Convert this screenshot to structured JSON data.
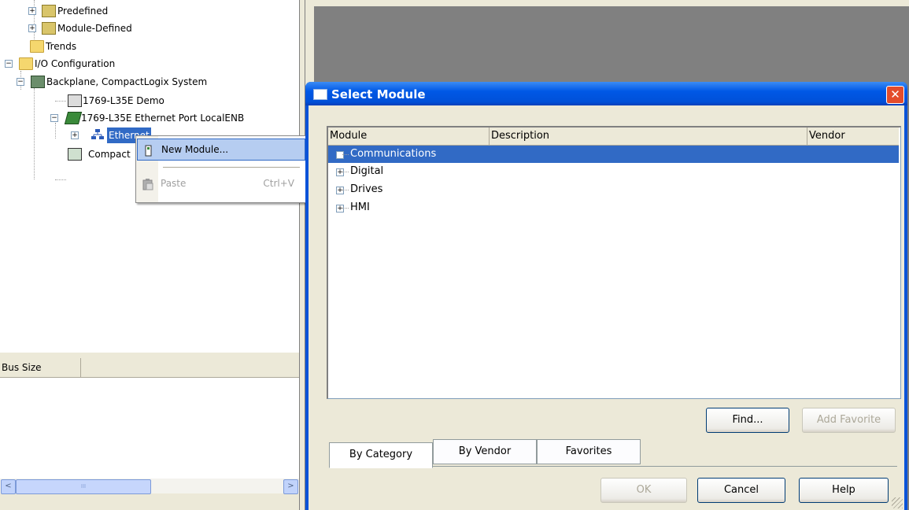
{
  "tree": {
    "items": [
      {
        "label": "Predefined",
        "expander": "+"
      },
      {
        "label": "Module-Defined",
        "expander": "+"
      },
      {
        "label": "Trends",
        "expander": ""
      },
      {
        "label": "I/O Configuration",
        "expander": "−"
      },
      {
        "label": "Backplane, CompactLogix System",
        "expander": "−"
      },
      {
        "label": "1769-L35E Demo",
        "expander": ""
      },
      {
        "label": "1769-L35E Ethernet Port LocalENB",
        "expander": "−"
      },
      {
        "label": "Ethernet",
        "expander": "+"
      },
      {
        "label": "Compact",
        "expander": ""
      }
    ]
  },
  "properties": {
    "column_header": "Bus Size"
  },
  "scrollbar": {
    "left_arrow": "<",
    "right_arrow": ">",
    "thumb_grip": "III"
  },
  "context_menu": {
    "items": [
      {
        "label": "New Module...",
        "shortcut": "",
        "icon": "new-module-icon"
      },
      {
        "label": "Paste",
        "shortcut": "Ctrl+V",
        "icon": "paste-icon"
      }
    ]
  },
  "dialog": {
    "title": "Select Module",
    "close_glyph": "✕",
    "columns": [
      "Module",
      "Description",
      "Vendor"
    ],
    "categories": [
      {
        "label": "Communications",
        "expander": "+",
        "selected": true
      },
      {
        "label": "Digital",
        "expander": "+",
        "selected": false
      },
      {
        "label": "Drives",
        "expander": "+",
        "selected": false
      },
      {
        "label": "HMI",
        "expander": "+",
        "selected": false
      }
    ],
    "find_button": "Find...",
    "add_favorite_button": "Add Favorite",
    "tabs": [
      "By Category",
      "By Vendor",
      "Favorites"
    ],
    "ok_button": "OK",
    "cancel_button": "Cancel",
    "help_button": "Help"
  },
  "colors": {
    "selection": "#316ac5",
    "titlebar": "#0058e6",
    "close": "#e44c2b",
    "workspace": "#808080"
  }
}
